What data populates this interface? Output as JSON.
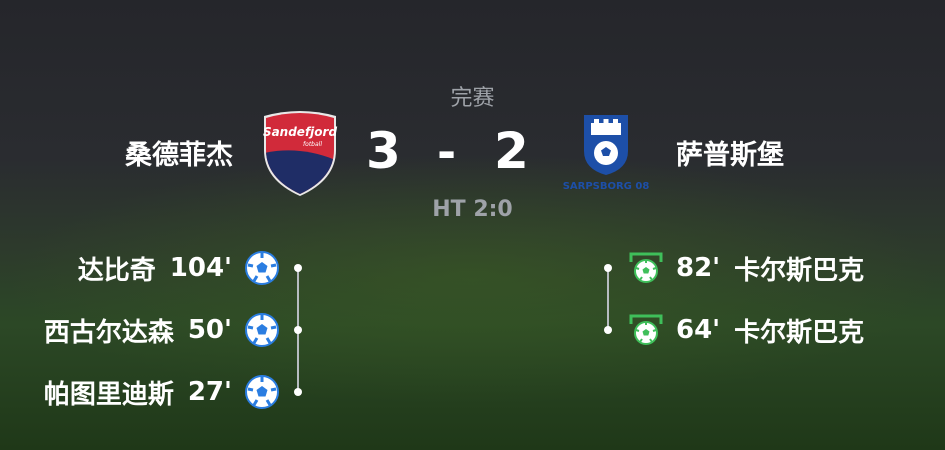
{
  "match": {
    "status": "完赛",
    "halftime": "HT 2:0",
    "home": {
      "name": "桑德菲杰",
      "score": "3",
      "logo_text": "Sandefjord",
      "logo_subtext": "fotball",
      "colors": {
        "red": "#d12a3a",
        "navy": "#1f2d66"
      }
    },
    "separator": "-",
    "away": {
      "name": "萨普斯堡",
      "score": "2",
      "logo_text": "SARPSBORG 08",
      "colors": {
        "blue": "#1d4fa8"
      }
    }
  },
  "events": {
    "home": [
      {
        "player": "达比奇",
        "minute": "104'",
        "icon": "soccer-ball-icon"
      },
      {
        "player": "西古尔达森",
        "minute": "50'",
        "icon": "soccer-ball-icon"
      },
      {
        "player": "帕图里迪斯",
        "minute": "27'",
        "icon": "soccer-ball-icon"
      }
    ],
    "away": [
      {
        "player": "卡尔斯巴克",
        "minute": "82'",
        "icon": "goal-net-ball-icon"
      },
      {
        "player": "卡尔斯巴克",
        "minute": "64'",
        "icon": "goal-net-ball-icon"
      }
    ]
  },
  "colors": {
    "ball_blue": "#2a7de1",
    "goal_green": "#3fbf5a",
    "muted_text": "#9ea2a8"
  }
}
